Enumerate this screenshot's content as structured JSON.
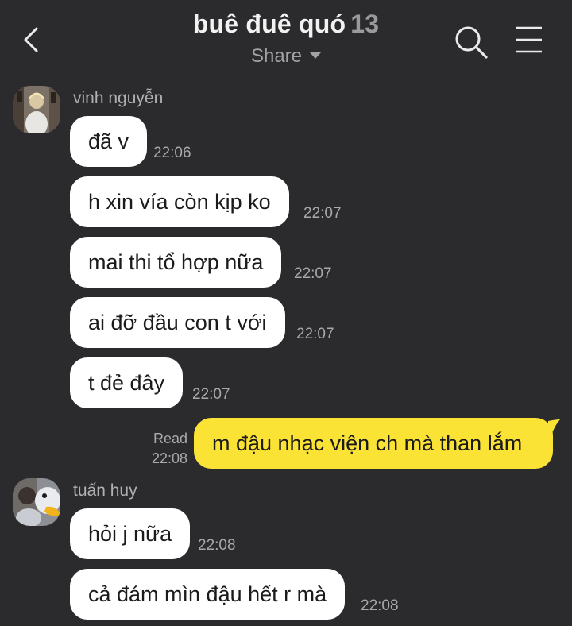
{
  "header": {
    "title": "buê đuê quó",
    "member_count": "13",
    "share_label": "Share",
    "back_icon": "chevron-left-icon",
    "search_icon": "search-icon",
    "menu_icon": "hamburger-menu-icon"
  },
  "colors": {
    "background": "#2b2b2d",
    "incoming_bubble": "#ffffff",
    "outgoing_bubble": "#fbe336",
    "muted_text": "#a9a9ab"
  },
  "messages": {
    "group1": {
      "sender": "vinh nguyễn",
      "items": [
        {
          "text": "đã v",
          "time": "22:06"
        },
        {
          "text": "h xin vía còn kịp ko",
          "time": "22:07"
        },
        {
          "text": "mai thi tổ hợp nữa",
          "time": "22:07"
        },
        {
          "text": "ai đỡ đầu con t với",
          "time": "22:07"
        },
        {
          "text": "t đẻ đây",
          "time": "22:07"
        }
      ]
    },
    "mine": {
      "text": "m đậu nhạc viện ch mà than lắm",
      "status": "Read",
      "time": "22:08"
    },
    "group2": {
      "sender": "tuấn huy",
      "items": [
        {
          "text": "hỏi j nữa",
          "time": "22:08"
        },
        {
          "text": "cả đám mìn đậu hết r mà",
          "time": "22:08"
        }
      ]
    }
  }
}
